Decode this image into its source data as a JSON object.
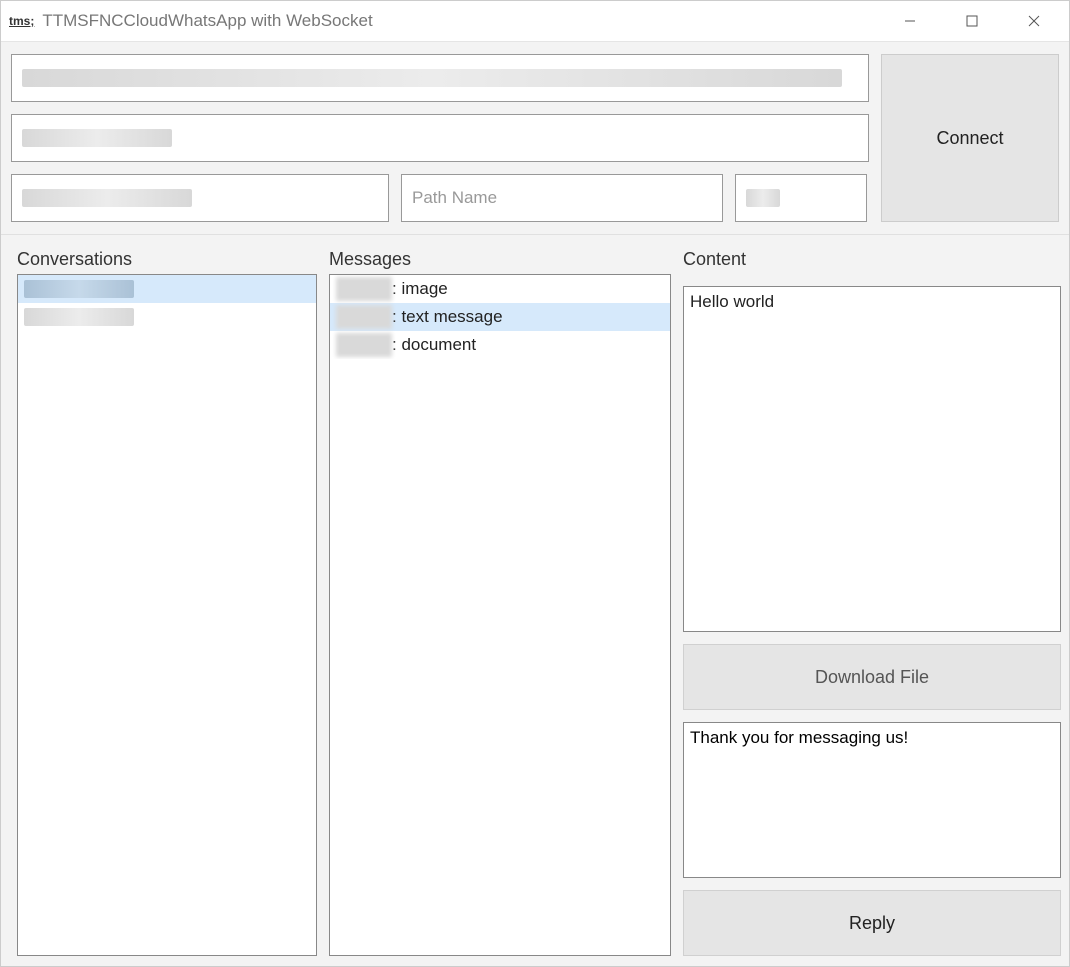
{
  "window": {
    "icon_text": "tms;",
    "title": "TTMSFNCCloudWhatsApp with WebSocket"
  },
  "top": {
    "field_a_value": "",
    "field_b_value": "",
    "field_c_value": "",
    "field_d_placeholder": "Path Name",
    "field_e_value": "",
    "connect_label": "Connect"
  },
  "labels": {
    "conversations": "Conversations",
    "messages": "Messages",
    "content": "Content"
  },
  "conversations": [
    {
      "text": "",
      "selected": true
    },
    {
      "text": "",
      "selected": false
    }
  ],
  "messages": [
    {
      "suffix": ": image",
      "selected": false
    },
    {
      "suffix": ": text message",
      "selected": true
    },
    {
      "suffix": ": document",
      "selected": false
    }
  ],
  "content": {
    "body": "Hello world",
    "download_label": "Download File",
    "reply_value": "Thank you for messaging us!",
    "reply_label": "Reply"
  }
}
